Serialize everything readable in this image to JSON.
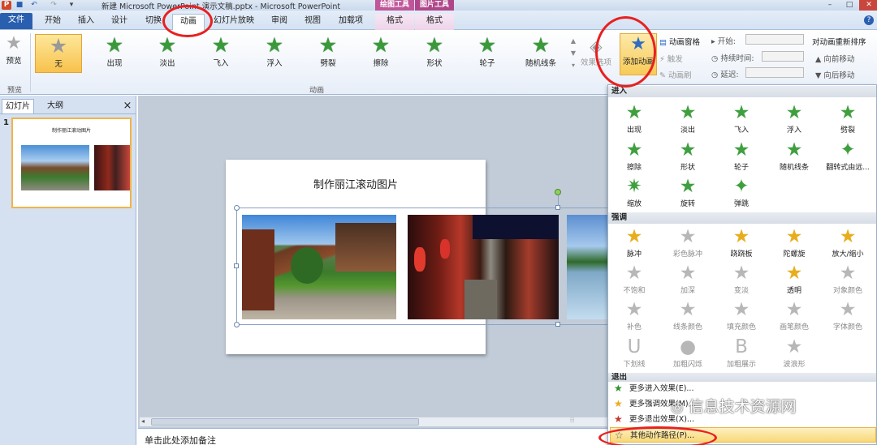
{
  "window": {
    "title": "新建 Microsoft PowerPoint 演示文稿.pptx - Microsoft PowerPoint",
    "context_group_drawing": "绘图工具",
    "context_group_picture": "图片工具"
  },
  "tabs": [
    "文件",
    "开始",
    "插入",
    "设计",
    "切换",
    "动画",
    "幻灯片放映",
    "审阅",
    "视图",
    "加载项",
    "格式",
    "格式"
  ],
  "ribbon": {
    "preview_label": "预览",
    "preview_group": "预览",
    "animation_group": "动画",
    "effects": [
      "无",
      "出现",
      "淡出",
      "飞入",
      "浮入",
      "劈裂",
      "擦除",
      "形状",
      "轮子",
      "随机线条"
    ],
    "effect_options": "效果选项",
    "add_animation": "添加动画",
    "animation_pane": "动画窗格",
    "trigger": "触发",
    "animation_painter": "动画刷",
    "start": "开始:",
    "duration": "持续时间:",
    "delay": "延迟:",
    "reorder_title": "对动画重新排序",
    "move_earlier": "向前移动",
    "move_later": "向后移动"
  },
  "left_pane": {
    "tab_slides": "幻灯片",
    "tab_outline": "大纲",
    "close": "×",
    "slide_number": "1",
    "thumb_title": "制作丽江滚动图片"
  },
  "slide": {
    "title": "制作丽江滚动图片"
  },
  "notes_placeholder": "单击此处添加备注",
  "dropdown": {
    "entrance_header": "进入",
    "entrance": [
      "出现",
      "淡出",
      "飞入",
      "浮入",
      "劈裂",
      "擦除",
      "形状",
      "轮子",
      "随机线条",
      "翻转式由远...",
      "缩放",
      "旋转",
      "弹跳"
    ],
    "emphasis_header": "强调",
    "emphasis": [
      "脉冲",
      "彩色脉冲",
      "跷跷板",
      "陀螺旋",
      "放大/缩小",
      "不饱和",
      "加深",
      "变淡",
      "透明",
      "对象颜色",
      "补色",
      "线条颜色",
      "填充颜色",
      "画笔颜色",
      "字体颜色",
      "下划线",
      "加粗闪烁",
      "加粗展示",
      "波浪形"
    ],
    "exit_header": "退出",
    "menu": [
      "更多进入效果(E)...",
      "更多强调效果(M)...",
      "更多退出效果(X)...",
      "其他动作路径(P)..."
    ]
  },
  "watermark": "信息技术资源网",
  "colors": {
    "accent_red": "#e82020",
    "file_tab": "#2a5fb0",
    "selected_effect": "#f8c24c"
  }
}
